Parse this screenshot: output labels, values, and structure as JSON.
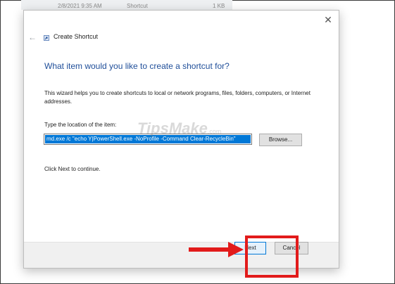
{
  "background_file_row": {
    "date": "2/8/2021 9:35 AM",
    "type": "Shortcut",
    "size": "1 KB"
  },
  "dialog": {
    "title": "Create Shortcut",
    "heading": "What item would you like to create a shortcut for?",
    "description": "This wizard helps you to create shortcuts to local or network programs, files, folders, computers, or Internet addresses.",
    "location_label": "Type the location of the item:",
    "location_value": "md.exe /c \"echo Y|PowerShell.exe -NoProfile -Command Clear-RecycleBin\"",
    "browse_label": "Browse...",
    "next_hint": "Click Next to continue.",
    "next_label": "Next",
    "cancel_label": "Cancel"
  },
  "watermark": {
    "main": "TipsMake",
    "suffix": ".com"
  },
  "colors": {
    "heading": "#1f4e99",
    "selection": "#0078d7",
    "highlight": "#e21b1b"
  },
  "icons": [
    "back-arrow-icon",
    "close-icon",
    "shortcut-icon",
    "red-arrow-icon"
  ]
}
